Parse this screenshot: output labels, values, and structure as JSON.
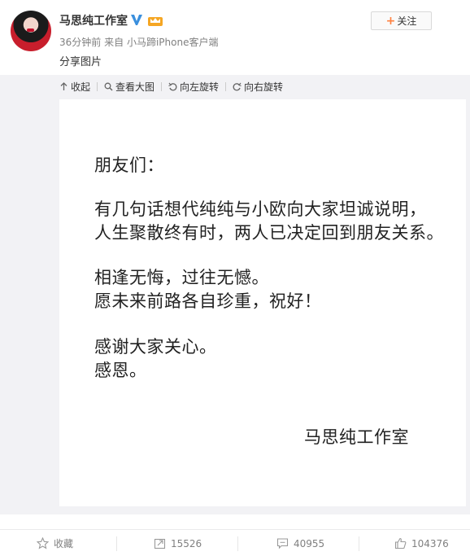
{
  "post": {
    "username": "马思纯工作室",
    "time": "36分钟前",
    "from_label": "来自",
    "source": "小马蹄iPhone客户端",
    "text": "分享图片",
    "follow_label": "关注"
  },
  "toolbar": {
    "collapse": "收起",
    "view_large": "查看大图",
    "rotate_left": "向左旋转",
    "rotate_right": "向右旋转"
  },
  "letter": {
    "greeting": "朋友们：",
    "line1": "有几句话想代纯纯与小欧向大家坦诚说明，",
    "line2": "人生聚散终有时，两人已决定回到朋友关系。",
    "line3": "相逢无悔，过往无憾。",
    "line4": "愿未来前路各自珍重，祝好！",
    "line5": "感谢大家关心。",
    "line6": "感恩。",
    "signature": "马思纯工作室"
  },
  "actions": {
    "favorite": "收藏",
    "repost_count": "15526",
    "comment_count": "40955",
    "like_count": "104376"
  },
  "colors": {
    "accent_orange": "#ff8140",
    "verified_blue": "#3a8fdd",
    "vip_gold": "#f5a623"
  }
}
